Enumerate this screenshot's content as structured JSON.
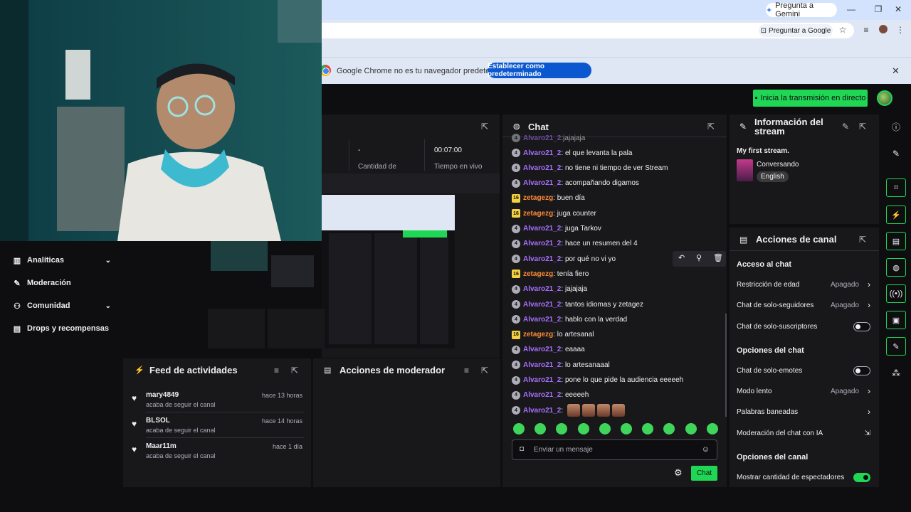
{
  "browser": {
    "gemini_label": "Pregunta a Gemini",
    "ask_google_label": "Preguntar a Google",
    "default_browser_text": "Google Chrome no es tu navegador predeterminado",
    "default_browser_button": "Establecer como predeterminado"
  },
  "top": {
    "go_live_label": "Inicia la transmisión en directo"
  },
  "left_nav": {
    "items": [
      {
        "label": "Analíticas"
      },
      {
        "label": "Moderación"
      },
      {
        "label": "Comunidad"
      },
      {
        "label": "Drops y recompensas"
      }
    ]
  },
  "stats": {
    "viewers_value": "-",
    "viewers_label": "Cantidad de",
    "live_value": "00:07:00",
    "live_label": "Tiempo en vivo"
  },
  "feed": {
    "title": "Feed de actividades",
    "items": [
      {
        "name": "mary4849",
        "time": "hace 13 horas",
        "sub": "acaba de seguir el canal"
      },
      {
        "name": "BLSOL",
        "time": "hace 14 horas",
        "sub": "acaba de seguir el canal"
      },
      {
        "name": "Maar11m",
        "time": "hace 1 día",
        "sub": "acaba de seguir el canal"
      }
    ]
  },
  "mod_actions": {
    "title": "Acciones de moderador"
  },
  "chat": {
    "title": "Chat",
    "partial_top": "jajajaja",
    "messages": [
      {
        "badge": "4",
        "user": "Alvaro21_2",
        "text": "el que levanta la pala"
      },
      {
        "badge": "4",
        "user": "Alvaro21_2",
        "text": "no tiene ni tiempo de ver Stream"
      },
      {
        "badge": "4",
        "user": "Alvaro21_2",
        "text": "acompañando digamos"
      },
      {
        "badge": "16",
        "user": "zetagezg",
        "text": "buen día"
      },
      {
        "badge": "16",
        "user": "zetagezg",
        "text": "juga counter"
      },
      {
        "badge": "4",
        "user": "Alvaro21_2",
        "text": "juga Tarkov"
      },
      {
        "badge": "4",
        "user": "Alvaro21_2",
        "text": "hace un resumen del 4"
      },
      {
        "badge": "4",
        "user": "Alvaro21_2",
        "text": "por qué no vi yo"
      },
      {
        "badge": "16",
        "user": "zetagezg",
        "text": "tenía fiero"
      },
      {
        "badge": "4",
        "user": "Alvaro21_2",
        "text": "jajajaja"
      },
      {
        "badge": "4",
        "user": "Alvaro21_2",
        "text": "tantos idiomas y zetagez"
      },
      {
        "badge": "4",
        "user": "Alvaro21_2",
        "text": "hablo con la verdad"
      },
      {
        "badge": "16",
        "user": "zetagezg",
        "text": "lo artesanal"
      },
      {
        "badge": "4",
        "user": "Alvaro21_2",
        "text": "eaaaa"
      },
      {
        "badge": "4",
        "user": "Alvaro21_2",
        "text": "lo artesanaaal"
      },
      {
        "badge": "4",
        "user": "Alvaro21_2",
        "text": "pone lo que pide la audiencia eeeeeh"
      },
      {
        "badge": "4",
        "user": "Alvaro21_2",
        "text": "eeeeeh"
      },
      {
        "badge": "4",
        "user": "Alvaro21_2",
        "text": ""
      }
    ],
    "input_placeholder": "Enviar un mensaje",
    "send_label": "Chat"
  },
  "stream_info": {
    "title_line1": "Información del",
    "title_line2": "stream",
    "stream_title": "My first stream.",
    "category": "Conversando",
    "language": "English"
  },
  "channel_actions": {
    "title": "Acciones de canal",
    "section_chat_access": "Acceso al chat",
    "age_restriction": "Restricción de edad",
    "age_restriction_value": "Apagado",
    "followers_only": "Chat de solo-seguidores",
    "followers_only_value": "Apagado",
    "subs_only": "Chat de solo-suscriptores",
    "section_chat_options": "Opciones del chat",
    "emotes_only": "Chat de solo-emotes",
    "slow_mode": "Modo lento",
    "slow_mode_value": "Apagado",
    "banned_words": "Palabras baneadas",
    "ai_moderation": "Moderación del chat con IA",
    "section_channel_options": "Opciones del canal",
    "show_viewer_count": "Mostrar cantidad de espectadores"
  }
}
